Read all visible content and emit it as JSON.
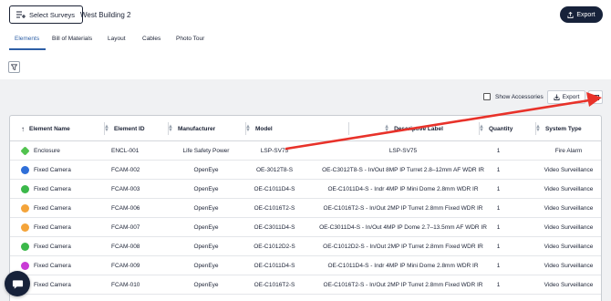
{
  "header": {
    "select_surveys_label": "Select Surveys",
    "building_name": "West Building 2",
    "export_label": "Export"
  },
  "tabs": [
    {
      "label": "Elements",
      "active": true
    },
    {
      "label": "Bill of Materials",
      "active": false
    },
    {
      "label": "Layout",
      "active": false
    },
    {
      "label": "Cables",
      "active": false
    },
    {
      "label": "Photo Tour",
      "active": false
    }
  ],
  "toolbar": {
    "show_accessories_label": "Show Accessories",
    "show_accessories_checked": false,
    "export_label": "Export"
  },
  "table": {
    "columns": [
      "Element Name",
      "Element ID",
      "Manufacturer",
      "Model",
      "Descriptive Label",
      "Quantity",
      "System Type"
    ],
    "rows": [
      {
        "name": "Enclosure",
        "icon_color": "#52c34f",
        "icon": "enclosure-icon",
        "id": "ENCL-001",
        "manufacturer": "Life Safety Power",
        "model": "LSP-SV75",
        "label": "LSP-SV75",
        "qty": "1",
        "system": "Fire Alarm"
      },
      {
        "name": "Fixed Camera",
        "icon_color": "#2f6fd8",
        "icon": "camera-icon",
        "id": "FCAM-002",
        "manufacturer": "OpenEye",
        "model": "OE-3012T8-S",
        "label": "OE-C3012T8-S - In/Out 8MP IP Turret 2.8–12mm AF WDR IR",
        "qty": "1",
        "system": "Video Surveillance"
      },
      {
        "name": "Fixed Camera",
        "icon_color": "#3bb84a",
        "icon": "camera-icon",
        "id": "FCAM-003",
        "manufacturer": "OpenEye",
        "model": "OE-C1011D4-S",
        "label": "OE-C1011D4-S - Indr 4MP IP Mini Dome 2.8mm WDR IR",
        "qty": "1",
        "system": "Video Surveillance"
      },
      {
        "name": "Fixed Camera",
        "icon_color": "#f4a43a",
        "icon": "camera-icon",
        "id": "FCAM-006",
        "manufacturer": "OpenEye",
        "model": "OE-C1016T2-S",
        "label": "OE-C1016T2-S - In/Out 2MP IP Turret 2.8mm Fixed WDR IR",
        "qty": "1",
        "system": "Video Surveillance"
      },
      {
        "name": "Fixed Camera",
        "icon_color": "#f4a43a",
        "icon": "camera-icon",
        "id": "FCAM-007",
        "manufacturer": "OpenEye",
        "model": "OE-C3011D4-S",
        "label": "OE-C3011D4-S - In/Out 4MP IP Dome 2.7–13.5mm AF WDR IR",
        "qty": "1",
        "system": "Video Surveillance"
      },
      {
        "name": "Fixed Camera",
        "icon_color": "#3bb84a",
        "icon": "camera-icon",
        "id": "FCAM-008",
        "manufacturer": "OpenEye",
        "model": "OE-C1012D2-S",
        "label": "OE-C1012D2-S - In/Out 2MP IP Turret 2.8mm Fixed WDR IR",
        "qty": "1",
        "system": "Video Surveillance"
      },
      {
        "name": "Fixed Camera",
        "icon_color": "#c93bd6",
        "icon": "camera-icon",
        "id": "FCAM-009",
        "manufacturer": "OpenEye",
        "model": "OE-C1011D4-S",
        "label": "OE-C1011D4-S - Indr 4MP IP Mini Dome 2.8mm WDR IR",
        "qty": "1",
        "system": "Video Surveillance"
      },
      {
        "name": "Fixed Camera",
        "icon_color": "#f4a43a",
        "icon": "camera-icon",
        "id": "FCAM-010",
        "manufacturer": "OpenEye",
        "model": "OE-C1016T2-S",
        "label": "OE-C1016T2-S - In/Out 2MP IP Turret 2.8mm Fixed WDR IR",
        "qty": "1",
        "system": "Video Surveillance"
      }
    ]
  },
  "annotation": {
    "arrow_color": "#e8322a"
  },
  "colors": {
    "primary": "#17223a",
    "accent": "#2d5fa6",
    "panel_bg": "#f0f1f3"
  }
}
